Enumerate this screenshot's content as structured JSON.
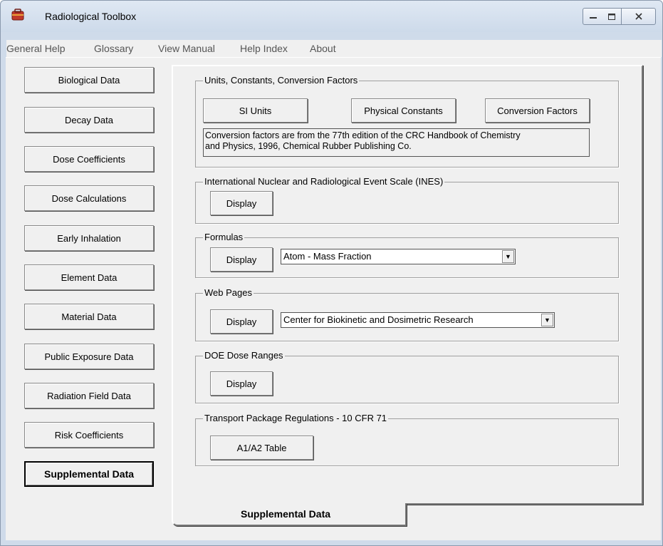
{
  "window": {
    "title": "Radiological Toolbox",
    "controls": {
      "minimize": "minimize",
      "maximize": "maximize",
      "close": "close"
    }
  },
  "menu": {
    "items": [
      "General Help",
      "Glossary",
      "View Manual",
      "Help Index",
      "About"
    ]
  },
  "sidebar": {
    "buttons": [
      "Biological Data",
      "Decay Data",
      "Dose Coefficients",
      "Dose Calculations",
      "Early Inhalation",
      "Element Data",
      "Material Data",
      "Public Exposure Data",
      "Radiation Field Data",
      "Risk Coefficients",
      "Supplemental Data"
    ],
    "active": "Supplemental Data"
  },
  "tab": {
    "label": "Supplemental Data"
  },
  "groups": {
    "units": {
      "title": "Units, Constants, Conversion Factors",
      "buttons": [
        "SI Units",
        "Physical Constants",
        "Conversion Factors"
      ],
      "note_line1": "Conversion factors are from  the 77th edition of the CRC Handbook of Chemistry",
      "note_line2": "and Physics, 1996, Chemical Rubber Publishing Co."
    },
    "ines": {
      "title": "International Nuclear and Radiological Event Scale (INES)",
      "button": "Display"
    },
    "formulas": {
      "title": "Formulas",
      "button": "Display",
      "selected": "Atom - Mass Fraction"
    },
    "web": {
      "title": "Web Pages",
      "button": "Display",
      "selected": "Center for Biokinetic and Dosimetric Research"
    },
    "doe": {
      "title": "DOE Dose Ranges",
      "button": "Display"
    },
    "transport": {
      "title": "Transport Package Regulations - 10 CFR 71",
      "button": "A1/A2 Table"
    }
  }
}
